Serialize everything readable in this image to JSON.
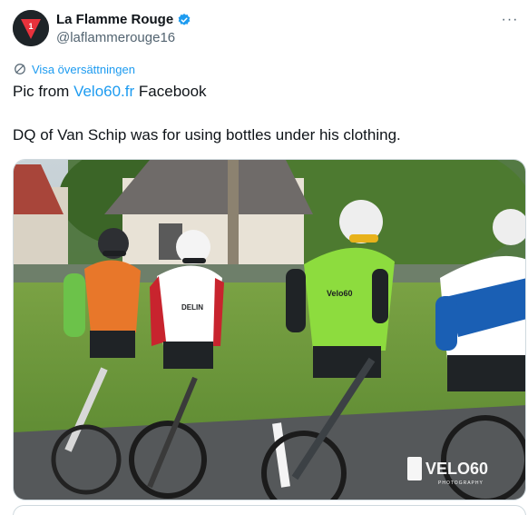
{
  "account": {
    "display_name": "La Flamme Rouge",
    "handle": "@laflammerouge16",
    "verified": true,
    "avatar_icon": "red-triangle-1-logo",
    "avatar_text": "1"
  },
  "menu": {
    "more_icon": "more-horizontal-icon",
    "more_label": "···"
  },
  "translation": {
    "icon": "translate-icon",
    "label": "Visa översättningen"
  },
  "tweet": {
    "text_before_link": "Pic from ",
    "link_text": "Velo60.fr",
    "text_after_link": " Facebook",
    "second_paragraph": "DQ of Van Schip was for using bottles under his clothing."
  },
  "media": {
    "watermark_main": "VELO60",
    "watermark_sub": "PHOTOGRAPHY",
    "jersey_text_1": "DELIN",
    "jersey_text_2": "Velo60"
  },
  "colors": {
    "link": "#1d9bf0",
    "secondary_text": "#536471",
    "primary_text": "#0f1419",
    "avatar_red": "#e8323c",
    "verified_blue": "#1d9bf0"
  }
}
